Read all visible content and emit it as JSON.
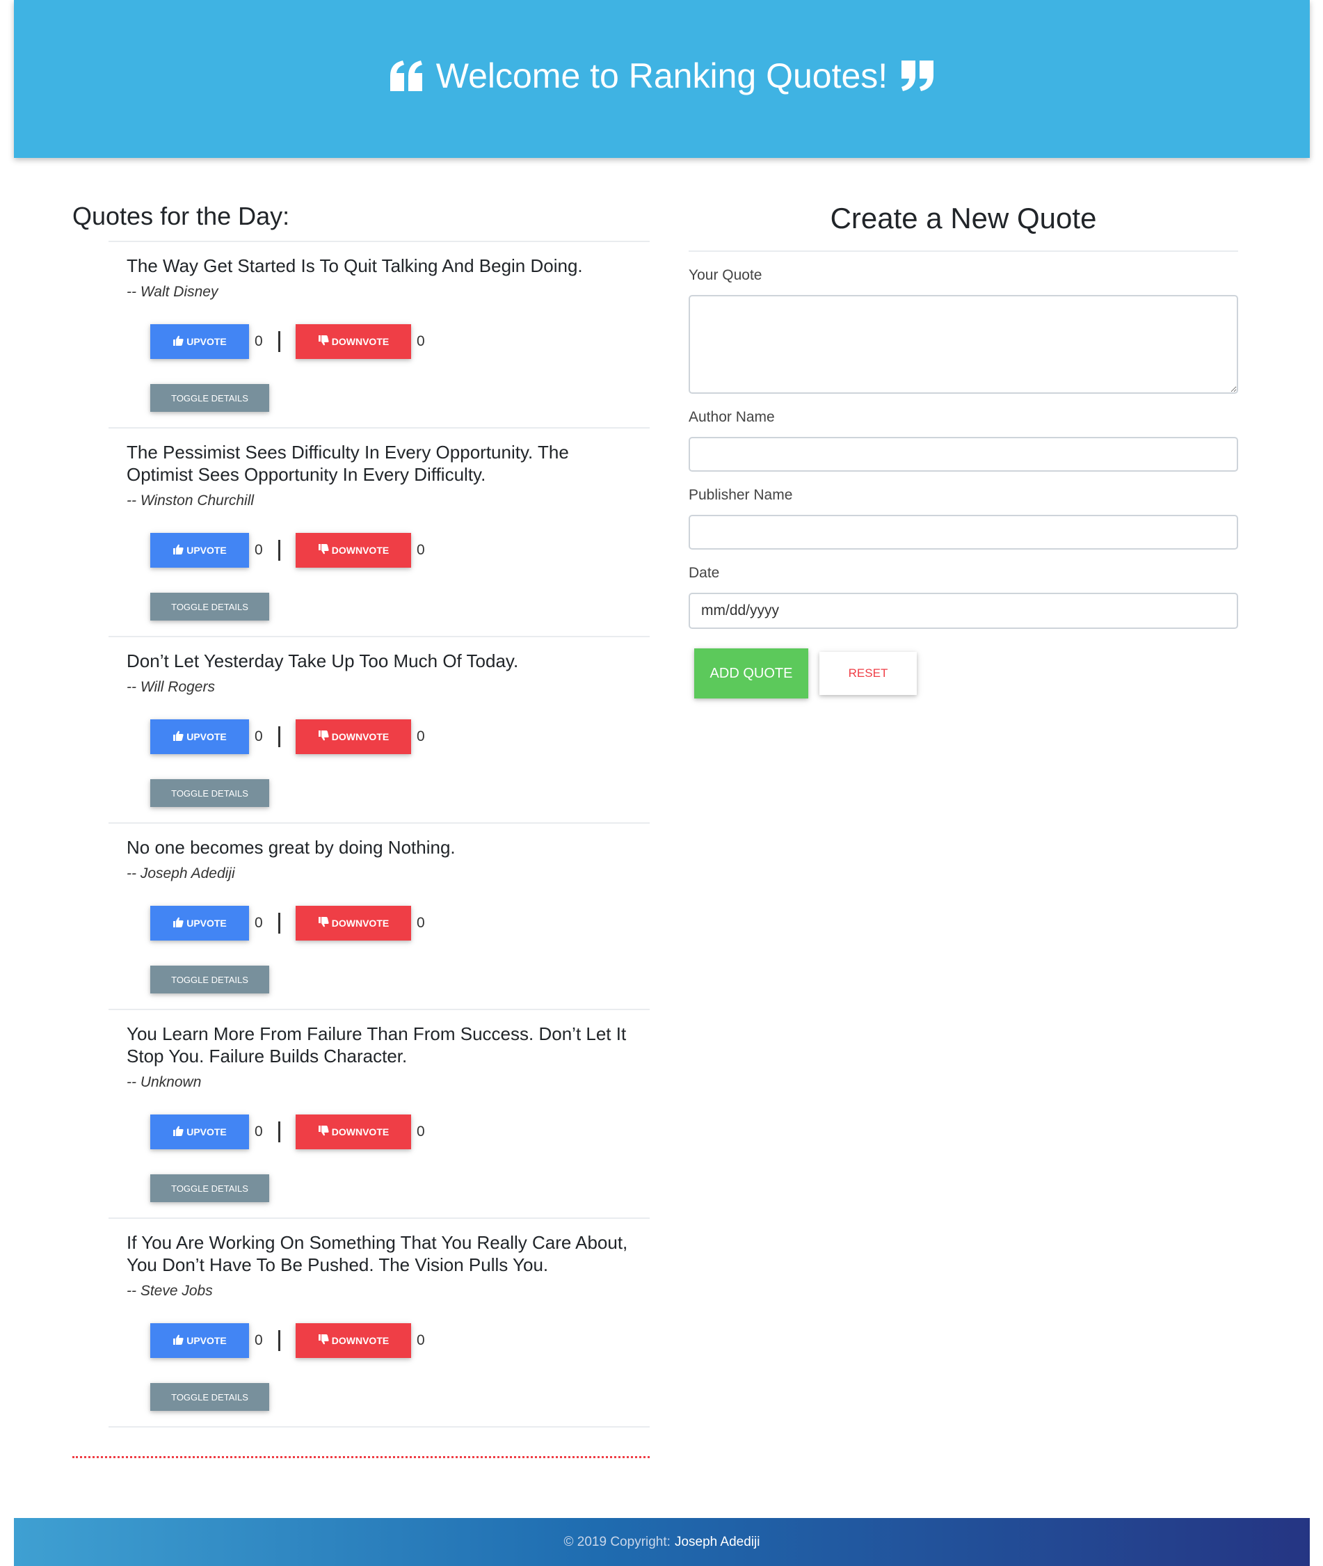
{
  "header": {
    "title": "Welcome to Ranking Quotes!",
    "left_icon": "quote-left-icon",
    "right_icon": "quote-right-icon",
    "bg_color": "#3fb3e3"
  },
  "quotes_section": {
    "title": "Quotes for the Day:",
    "upvote_label": "UPVOTE",
    "downvote_label": "DOWNVOTE",
    "toggle_label": "TOGGLE DETAILS",
    "items": [
      {
        "text": "The Way Get Started Is To Quit Talking And Begin Doing.",
        "author": "-- Walt Disney",
        "upvotes": "0",
        "downvotes": "0"
      },
      {
        "text": "The Pessimist Sees Difficulty In Every Opportunity. The Optimist Sees Opportunity In Every Difficulty.",
        "author": "-- Winston Churchill",
        "upvotes": "0",
        "downvotes": "0"
      },
      {
        "text": "Don’t Let Yesterday Take Up Too Much Of Today.",
        "author": "-- Will Rogers",
        "upvotes": "0",
        "downvotes": "0"
      },
      {
        "text": "No one becomes great by doing Nothing.",
        "author": "-- Joseph Adediji",
        "upvotes": "0",
        "downvotes": "0"
      },
      {
        "text": "You Learn More From Failure Than From Success. Don’t Let It Stop You. Failure Builds Character.",
        "author": "-- Unknown",
        "upvotes": "0",
        "downvotes": "0"
      },
      {
        "text": "If You Are Working On Something That You Really Care About, You Don’t Have To Be Pushed. The Vision Pulls You.",
        "author": "-- Steve Jobs",
        "upvotes": "0",
        "downvotes": "0"
      }
    ]
  },
  "form": {
    "title": "Create a New Quote",
    "quote_label": "Your Quote",
    "quote_value": "",
    "author_label": "Author Name",
    "author_value": "",
    "publisher_label": "Publisher Name",
    "publisher_value": "",
    "date_label": "Date",
    "date_placeholder": "mm/dd/yyyy",
    "add_label": "ADD QUOTE",
    "reset_label": "RESET"
  },
  "footer": {
    "copyright": "© 2019 Copyright:",
    "owner": "Joseph Adediji"
  },
  "colors": {
    "upvote": "#4285f4",
    "downvote": "#ef3e46",
    "toggle": "#78909c",
    "add": "#5cc95b"
  }
}
